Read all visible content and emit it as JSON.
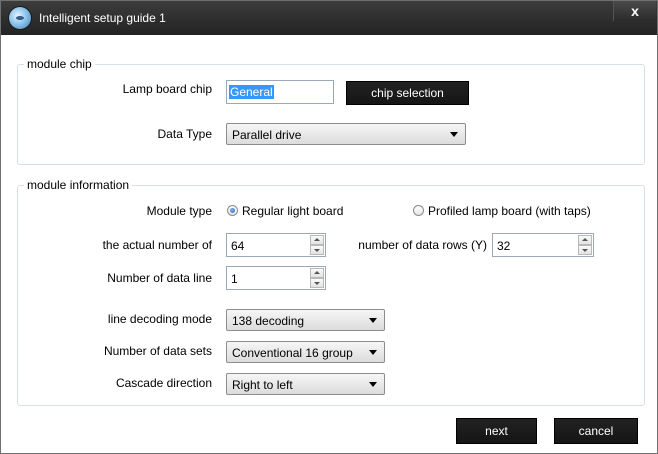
{
  "window": {
    "title": "Intelligent setup guide 1",
    "close_glyph": "x",
    "icon": "app-disc-icon"
  },
  "module_chip": {
    "legend": "module chip",
    "lamp_board_chip_label": "Lamp board chip",
    "lamp_board_chip_value": "General",
    "chip_selection_button": "chip selection",
    "data_type_label": "Data Type",
    "data_type_value": "Parallel drive"
  },
  "module_info": {
    "legend": "module information",
    "module_type_label": "Module type",
    "module_type_options": [
      {
        "label": "Regular light board",
        "selected": true
      },
      {
        "label": "Profiled lamp board (with taps)",
        "selected": false
      }
    ],
    "actual_number_label": "the actual number of",
    "actual_number_value": "64",
    "data_rows_label": "number of data rows (Y)",
    "data_rows_value": "32",
    "data_line_label": "Number of data line",
    "data_line_value": "1",
    "line_decoding_label": "line decoding mode",
    "line_decoding_value": "138 decoding",
    "data_sets_label": "Number of data sets",
    "data_sets_value": "Conventional 16 group",
    "cascade_label": "Cascade direction",
    "cascade_value": "Right to left"
  },
  "footer": {
    "next_button": "next",
    "cancel_button": "cancel"
  },
  "colors": {
    "titlebar": "#2e2e2e",
    "button_dark": "#1c1c1c",
    "selection": "#3399ff",
    "group_border": "#d5dfe5"
  }
}
